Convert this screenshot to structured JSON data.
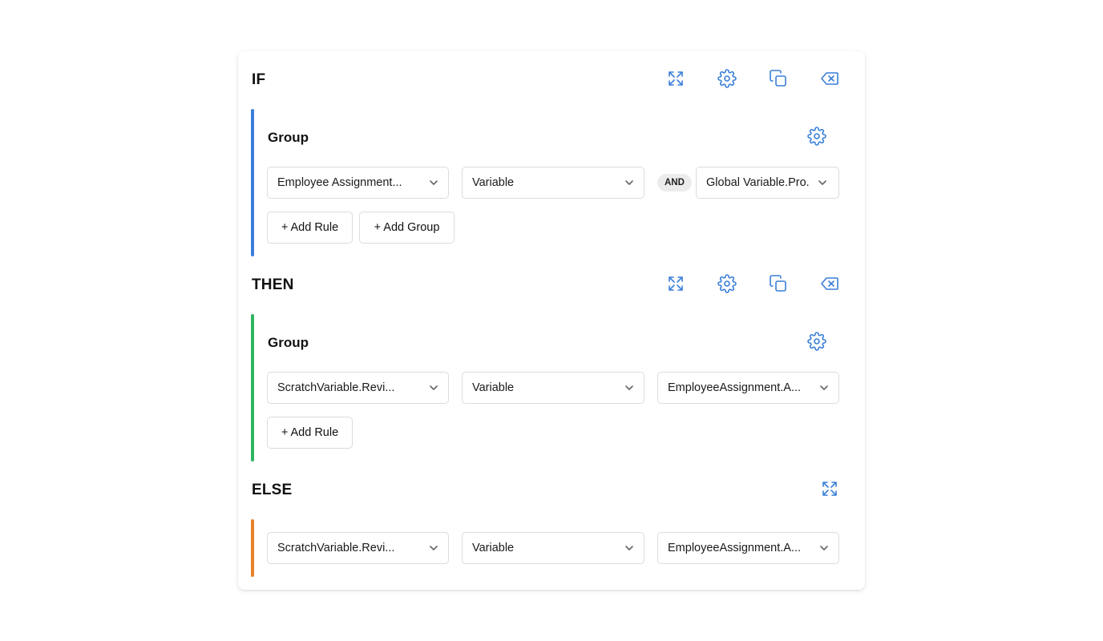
{
  "colors": {
    "accent": "#3a7fd8",
    "if_bar": "#3b7fdd",
    "then_bar": "#2fb562",
    "else_bar": "#e8822a"
  },
  "if_block": {
    "title": "IF",
    "icons": [
      "expand-icon",
      "gear-icon",
      "copy-icon",
      "backspace-delete-icon"
    ],
    "group": {
      "title": "Group",
      "rule": {
        "field": "Employee Assignment...",
        "operator": "Variable",
        "combinator": "AND",
        "value": "Global Variable.Pro..."
      },
      "add_rule_label": "+ Add Rule",
      "add_group_label": "+ Add Group"
    }
  },
  "then_block": {
    "title": "THEN",
    "icons": [
      "expand-icon",
      "gear-icon",
      "copy-icon",
      "backspace-delete-icon"
    ],
    "group": {
      "title": "Group",
      "rule": {
        "field": "ScratchVariable.Revi...",
        "operator": "Variable",
        "value": "EmployeeAssignment.A..."
      },
      "add_rule_label": "+ Add Rule"
    }
  },
  "else_block": {
    "title": "ELSE",
    "icons": [
      "expand-icon"
    ],
    "rule": {
      "field": "ScratchVariable.Revi...",
      "operator": "Variable",
      "value": "EmployeeAssignment.A..."
    }
  }
}
